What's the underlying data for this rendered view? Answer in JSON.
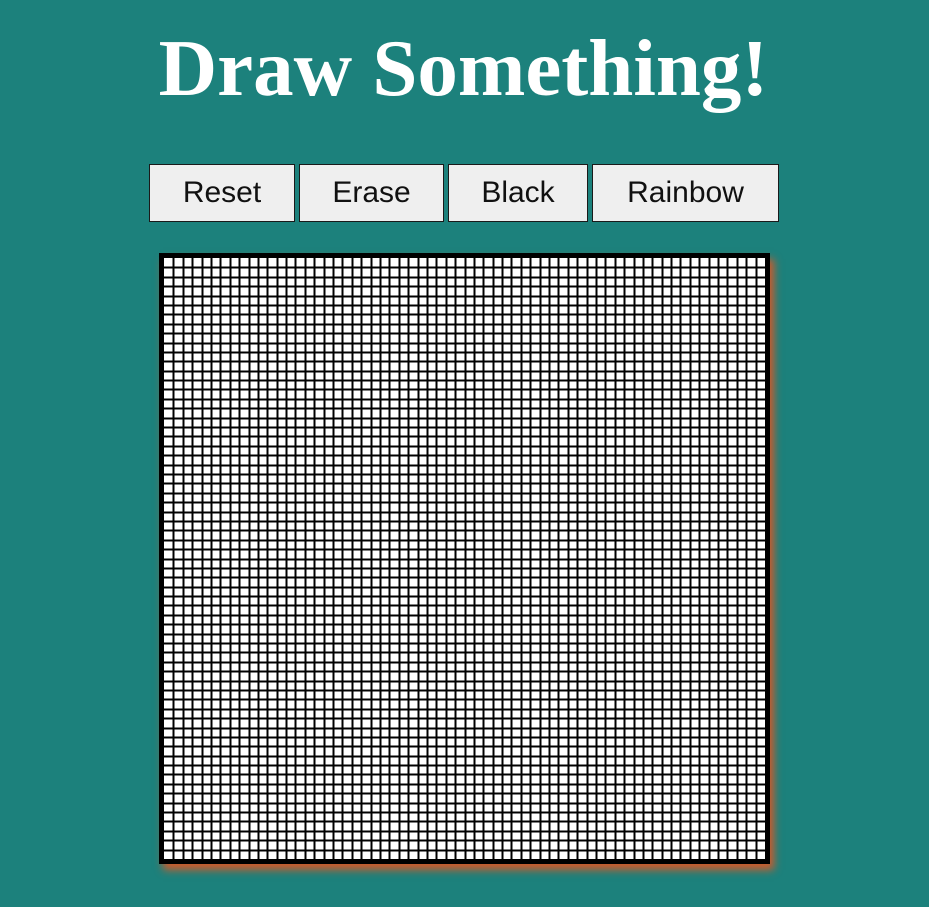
{
  "header": {
    "title": "Draw Something!"
  },
  "toolbar": {
    "buttons": [
      {
        "label": "Reset"
      },
      {
        "label": "Erase"
      },
      {
        "label": "Black"
      },
      {
        "label": "Rainbow"
      }
    ]
  },
  "sketchpad": {
    "grid_cells_per_side": 64,
    "cell_color": "#ffffff",
    "gridline_color": "#000000"
  },
  "colors": {
    "background": "#1c817c",
    "title_text": "#ffffff",
    "button_background": "#efefef",
    "frame_border": "#000000",
    "frame_shadow": "#d15a2a"
  }
}
